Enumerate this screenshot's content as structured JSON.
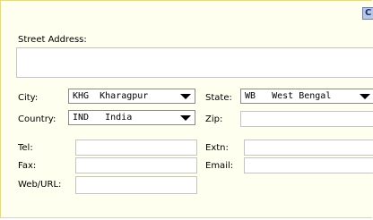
{
  "corner_button_label": "C",
  "street": {
    "label": "Street Address:",
    "value": ""
  },
  "city": {
    "label": "City:",
    "code": "KHG",
    "name": "Kharagpur"
  },
  "state": {
    "label": "State:",
    "code": "WB",
    "name": "West Bengal"
  },
  "country": {
    "label": "Country:",
    "code": "IND",
    "name": "India"
  },
  "zip": {
    "label": "Zip:",
    "value": ""
  },
  "tel": {
    "label": "Tel:",
    "value": ""
  },
  "extn": {
    "label": "Extn:",
    "value": ""
  },
  "fax": {
    "label": "Fax:",
    "value": ""
  },
  "email": {
    "label": "Email:",
    "value": ""
  },
  "web": {
    "label": "Web/URL:",
    "value": ""
  }
}
